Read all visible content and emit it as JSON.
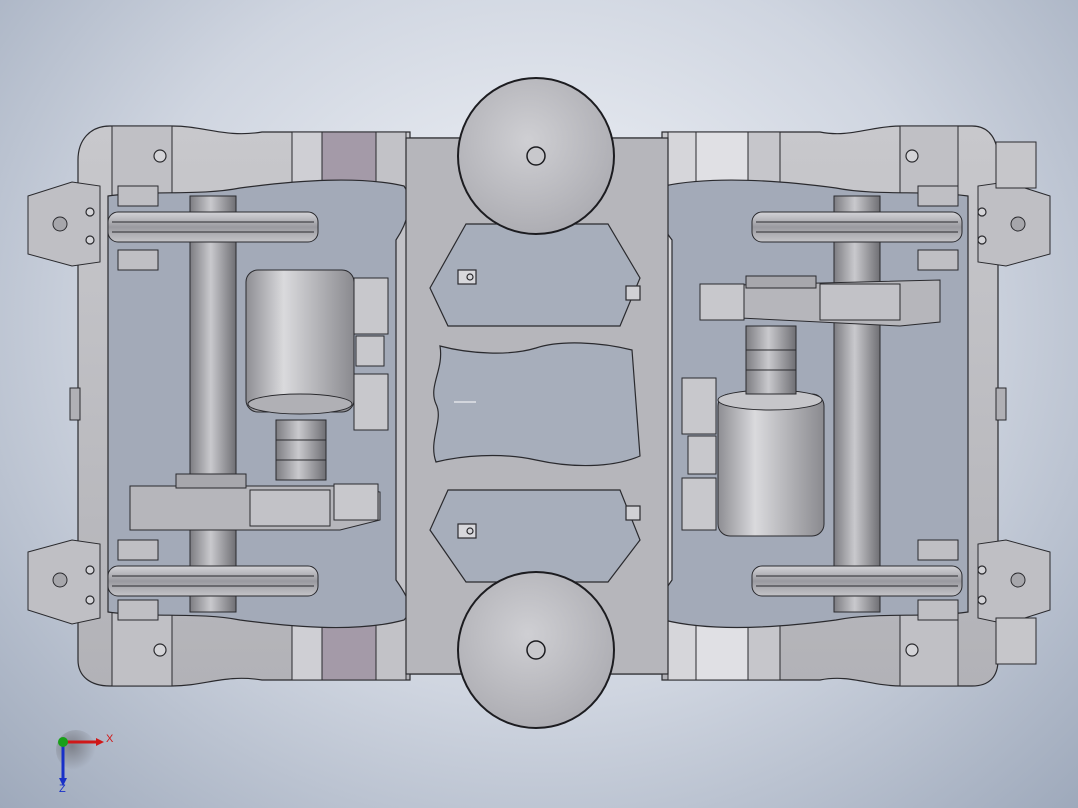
{
  "viewport": {
    "background_top": "#f4f6fa",
    "background_bottom": "#9ea9bb"
  },
  "model": {
    "frame_color": "#b9b9bd",
    "frame_shadow": "#8c8c92",
    "accent_purple": "#a49aa8",
    "outline_color": "#2a2a2e"
  },
  "triad": {
    "x_label": "X",
    "z_label": "Z",
    "x_color": "#d01818",
    "y_color": "#18a018",
    "z_color": "#1830c8"
  }
}
